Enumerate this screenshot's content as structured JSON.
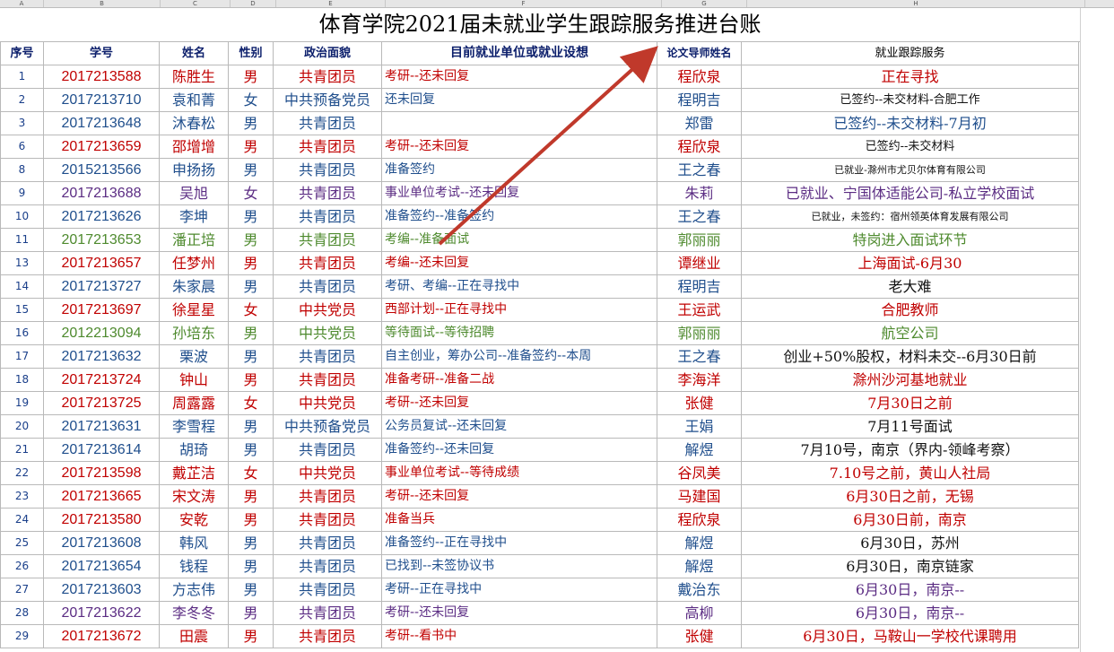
{
  "column_letters": [
    "A",
    "B",
    "C",
    "D",
    "E",
    "F",
    "G",
    "H"
  ],
  "title": "体育学院2021届未就业学生跟踪服务推进台账",
  "headers": {
    "no": "序号",
    "id": "学号",
    "name": "姓名",
    "sex": "性别",
    "political": "政治面貌",
    "plan": "目前就业单位或就业设想",
    "supervisor": "论文导师姓名",
    "service": "就业跟踪服务"
  },
  "colors": {
    "red": "#c00000",
    "blue": "#1f4e8c",
    "green": "#4e8a2e",
    "purple": "#5b2c83",
    "arrow": "#c0392b"
  },
  "rows": [
    {
      "no": "1",
      "id": "2017213588",
      "name": "陈胜生",
      "sex": "男",
      "political": "共青团员",
      "plan": "考研--还未回复",
      "supervisor": "程欣泉",
      "service": "正在寻找",
      "color": "red",
      "svc_size": 16
    },
    {
      "no": "2",
      "id": "2017213710",
      "name": "袁和菁",
      "sex": "女",
      "political": "中共预备党员",
      "plan": "还未回复",
      "supervisor": "程明吉",
      "service": "已签约--未交材料-合肥工作",
      "color": "blue",
      "svc_size": 13,
      "svc_color": "dark"
    },
    {
      "no": "3",
      "id": "2017213648",
      "name": "沐春松",
      "sex": "男",
      "political": "共青团员",
      "plan": "",
      "supervisor": "郑雷",
      "service": "已签约--未交材料-7月初",
      "color": "blue",
      "svc_size": 16
    },
    {
      "no": "6",
      "id": "2017213659",
      "name": "邵增增",
      "sex": "男",
      "political": "共青团员",
      "plan": "考研--还未回复",
      "supervisor": "程欣泉",
      "service": "已签约--未交材料",
      "color": "red",
      "svc_size": 13,
      "svc_color": "dark"
    },
    {
      "no": "8",
      "id": "2015213566",
      "name": "申扬扬",
      "sex": "男",
      "political": "共青团员",
      "plan": "准备签约",
      "supervisor": "王之春",
      "service": "已就业-滁州市尤贝尔体育有限公司",
      "color": "blue",
      "svc_size": 11,
      "svc_color": "dark"
    },
    {
      "no": "9",
      "id": "2017213688",
      "name": "吴旭",
      "sex": "女",
      "political": "共青团员",
      "plan": "事业单位考试--还未回复",
      "supervisor": "朱莉",
      "service": "已就业、宁国体适能公司-私立学校面试",
      "color": "purple",
      "svc_size": 16
    },
    {
      "no": "10",
      "id": "2017213626",
      "name": "李坤",
      "sex": "男",
      "political": "共青团员",
      "plan": "准备签约--准备签约",
      "supervisor": "王之春",
      "service": "已就业，未签约：宿州领英体育发展有限公司",
      "color": "blue",
      "svc_size": 11,
      "svc_color": "dark"
    },
    {
      "no": "11",
      "id": "2017213653",
      "name": "潘正培",
      "sex": "男",
      "political": "共青团员",
      "plan": "考编--准备面试",
      "supervisor": "郭丽丽",
      "service": "特岗进入面试环节",
      "color": "green",
      "svc_size": 16
    },
    {
      "no": "13",
      "id": "2017213657",
      "name": "任梦州",
      "sex": "男",
      "political": "共青团员",
      "plan": "考编--还未回复",
      "supervisor": "谭继业",
      "service": "上海面试-6月30",
      "color": "red",
      "svc_size": 16
    },
    {
      "no": "14",
      "id": "2017213727",
      "name": "朱家晨",
      "sex": "男",
      "political": "共青团员",
      "plan": "考研、考编--正在寻找中",
      "supervisor": "程明吉",
      "service": "老大难",
      "color": "blue",
      "svc_size": 16,
      "svc_color": "dark"
    },
    {
      "no": "15",
      "id": "2017213697",
      "name": "徐星星",
      "sex": "女",
      "political": "中共党员",
      "plan": "西部计划--正在寻找中",
      "supervisor": "王运武",
      "service": "合肥教师",
      "color": "red",
      "svc_size": 16
    },
    {
      "no": "16",
      "id": "2012213094",
      "name": "孙培东",
      "sex": "男",
      "political": "中共党员",
      "plan": "等待面试--等待招聘",
      "supervisor": "郭丽丽",
      "service": "航空公司",
      "color": "green",
      "svc_size": 16
    },
    {
      "no": "17",
      "id": "2017213632",
      "name": "栗波",
      "sex": "男",
      "political": "共青团员",
      "plan": "自主创业，筹办公司--准备签约--本周",
      "supervisor": "王之春",
      "service": "创业+50%股权，材料未交--6月30日前",
      "color": "blue",
      "svc_size": 16,
      "svc_color": "dark"
    },
    {
      "no": "18",
      "id": "2017213724",
      "name": "钟山",
      "sex": "男",
      "political": "共青团员",
      "plan": "准备考研--准备二战",
      "supervisor": "李海洋",
      "service": "滁州沙河基地就业",
      "color": "red",
      "svc_size": 16
    },
    {
      "no": "19",
      "id": "2017213725",
      "name": "周露露",
      "sex": "女",
      "political": "中共党员",
      "plan": "考研--还未回复",
      "supervisor": "张健",
      "service": "7月30日之前",
      "color": "red",
      "svc_size": 16
    },
    {
      "no": "20",
      "id": "2017213631",
      "name": "李雪程",
      "sex": "男",
      "political": "中共预备党员",
      "plan": "公务员复试--还未回复",
      "supervisor": "王娟",
      "service": "7月11号面试",
      "color": "blue",
      "svc_size": 16,
      "svc_color": "dark"
    },
    {
      "no": "21",
      "id": "2017213614",
      "name": "胡琦",
      "sex": "男",
      "political": "共青团员",
      "plan": "准备签约--还未回复",
      "supervisor": "解煜",
      "service": "7月10号，南京（界内-领峰考察）",
      "color": "blue",
      "svc_size": 16,
      "svc_color": "dark"
    },
    {
      "no": "22",
      "id": "2017213598",
      "name": "戴芷洁",
      "sex": "女",
      "political": "中共党员",
      "plan": "事业单位考试--等待成绩",
      "supervisor": "谷凤美",
      "service": "7.10号之前，黄山人社局",
      "color": "red",
      "svc_size": 16
    },
    {
      "no": "23",
      "id": "2017213665",
      "name": "宋文涛",
      "sex": "男",
      "political": "共青团员",
      "plan": "考研--还未回复",
      "supervisor": "马建国",
      "service": "6月30日之前，无锡",
      "color": "red",
      "svc_size": 16
    },
    {
      "no": "24",
      "id": "2017213580",
      "name": "安乾",
      "sex": "男",
      "political": "共青团员",
      "plan": "准备当兵",
      "supervisor": "程欣泉",
      "service": "6月30日前，南京",
      "color": "red",
      "svc_size": 16
    },
    {
      "no": "25",
      "id": "2017213608",
      "name": "韩风",
      "sex": "男",
      "political": "共青团员",
      "plan": "准备签约--正在寻找中",
      "supervisor": "解煜",
      "service": "6月30日，苏州",
      "color": "blue",
      "svc_size": 16,
      "svc_color": "dark"
    },
    {
      "no": "26",
      "id": "2017213654",
      "name": "钱程",
      "sex": "男",
      "political": "共青团员",
      "plan": "已找到--未签协议书",
      "supervisor": "解煜",
      "service": "6月30日，南京链家",
      "color": "blue",
      "svc_size": 16,
      "svc_color": "dark"
    },
    {
      "no": "27",
      "id": "2017213603",
      "name": "方志伟",
      "sex": "男",
      "political": "共青团员",
      "plan": "考研--正在寻找中",
      "supervisor": "戴治东",
      "service": "6月30日，南京--",
      "color": "blue",
      "svc_size": 16,
      "svc_color": "purple"
    },
    {
      "no": "28",
      "id": "2017213622",
      "name": "李冬冬",
      "sex": "男",
      "political": "共青团员",
      "plan": "考研--还未回复",
      "supervisor": "高柳",
      "service": "6月30日，南京--",
      "color": "purple",
      "svc_size": 16
    },
    {
      "no": "29",
      "id": "2017213672",
      "name": "田震",
      "sex": "男",
      "political": "共青团员",
      "plan": "考研--看书中",
      "supervisor": "张健",
      "service": "6月30日，马鞍山一学校代课聘用",
      "color": "red",
      "svc_size": 16
    }
  ]
}
